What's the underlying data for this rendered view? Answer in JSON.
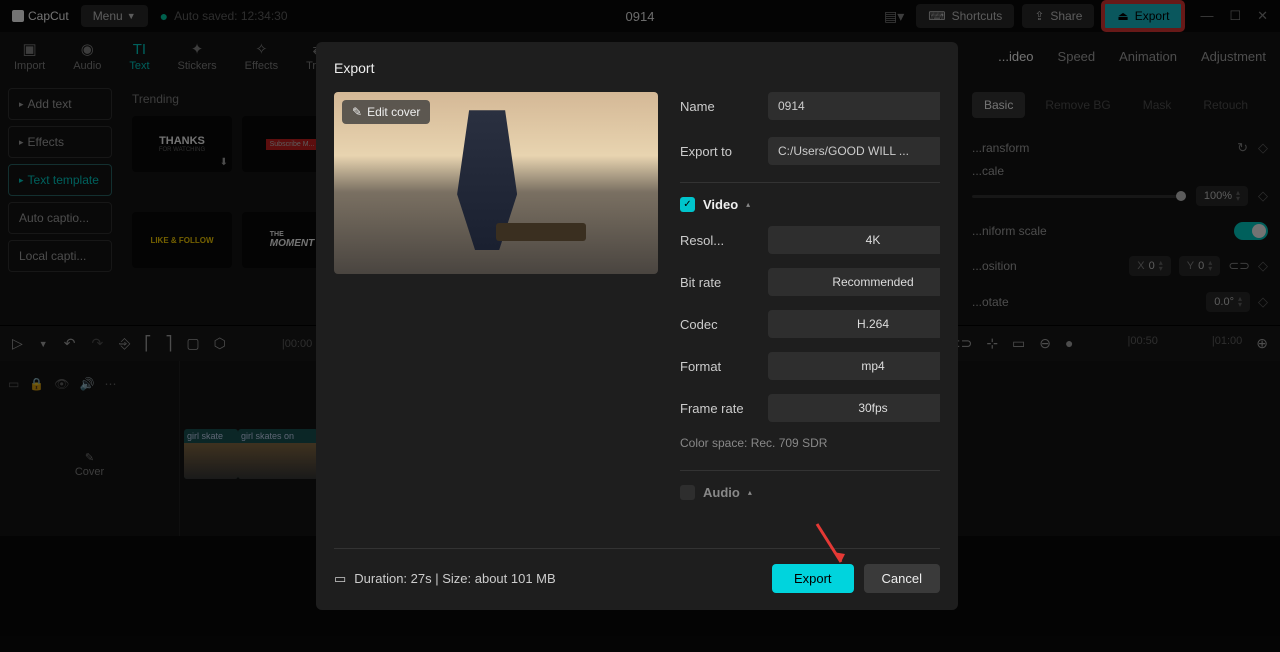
{
  "app": {
    "name": "CapCut",
    "project": "0914",
    "autosave": "Auto saved: 12:34:30"
  },
  "topbar": {
    "menu": "Menu",
    "shortcuts": "Shortcuts",
    "share": "Share",
    "export": "Export"
  },
  "tabs": {
    "left": [
      {
        "icon": "▣",
        "label": "Import"
      },
      {
        "icon": "◉",
        "label": "Audio"
      },
      {
        "icon": "TI",
        "label": "Text"
      },
      {
        "icon": "✦",
        "label": "Stickers"
      },
      {
        "icon": "✧",
        "label": "Effects"
      },
      {
        "icon": "⇄",
        "label": "Tra..."
      }
    ],
    "right": [
      "...ideo",
      "Speed",
      "Animation",
      "Adjustment"
    ]
  },
  "sidebar": {
    "items": [
      {
        "label": "Add text"
      },
      {
        "label": "Effects"
      },
      {
        "label": "Text template"
      },
      {
        "label": "Auto captio..."
      },
      {
        "label": "Local capti..."
      }
    ]
  },
  "media": {
    "section": "Trending",
    "thumbs": {
      "thanks": "THANKS",
      "thanks_sub": "FOR WATCHING",
      "sub": "Subscribe M...",
      "like": "LIKE & FOLLOW",
      "moment_pre": "THE",
      "moment": "MOMENT"
    }
  },
  "inspector": {
    "tabs": [
      "Basic",
      "Remove BG",
      "Mask",
      "Retouch"
    ],
    "transform": "...ransform",
    "scale": "...cale",
    "scale_val": "100%",
    "uniform": "...niform scale",
    "position": "...osition",
    "pos_x_label": "X",
    "pos_x": "0",
    "pos_y_label": "Y",
    "pos_y": "0",
    "rotate": "...otate",
    "rotate_val": "0.0°"
  },
  "timeline": {
    "ruler": [
      "|00:00",
      "|00:50",
      "|01:00"
    ],
    "clips": [
      "girl skate",
      "girl skates on"
    ],
    "cover": "Cover"
  },
  "modal": {
    "title": "Export",
    "edit_cover": "Edit cover",
    "name_label": "Name",
    "name_val": "0914",
    "exportto_label": "Export to",
    "exportto_val": "C:/Users/GOOD WILL ...",
    "video_section": "Video",
    "resolution_label": "Resol...",
    "resolution_val": "4K",
    "bitrate_label": "Bit rate",
    "bitrate_val": "Recommended",
    "codec_label": "Codec",
    "codec_val": "H.264",
    "format_label": "Format",
    "format_val": "mp4",
    "framerate_label": "Frame rate",
    "framerate_val": "30fps",
    "colorspace": "Color space: Rec. 709 SDR",
    "audio_section": "Audio",
    "duration": "Duration: 27s | Size: about 101 MB",
    "export_btn": "Export",
    "cancel_btn": "Cancel"
  }
}
